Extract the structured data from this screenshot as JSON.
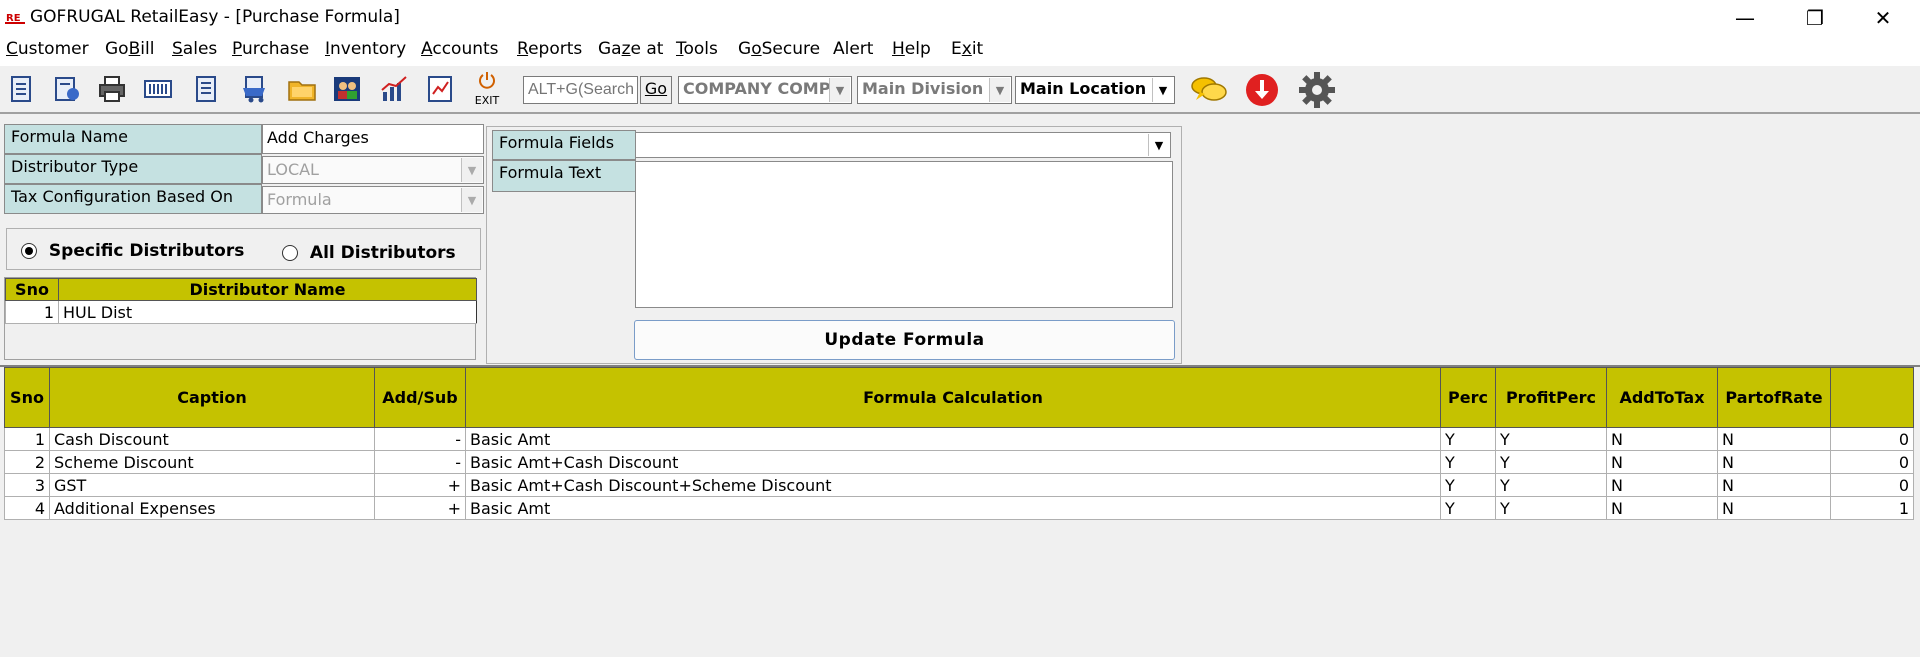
{
  "window": {
    "title": "GOFRUGAL RetailEasy - [Purchase Formula]",
    "min_glyph": "—",
    "restore_glyph": "❐",
    "close_glyph": "✕"
  },
  "menu": [
    {
      "label": "Customer",
      "u": "C",
      "rest": "ustomer"
    },
    {
      "label": "GoBill",
      "u": "",
      "pre": "Go",
      "ul": "B",
      "post": "ill"
    },
    {
      "label": "Sales",
      "u": "S",
      "rest": "ales"
    },
    {
      "label": "Purchase",
      "u": "P",
      "rest": "urchase"
    },
    {
      "label": "Inventory",
      "u": "I",
      "rest": "nventory"
    },
    {
      "label": "Accounts",
      "u": "A",
      "rest": "ccounts"
    },
    {
      "label": "Reports",
      "u": "R",
      "rest": "eports"
    },
    {
      "label": "Gaze at",
      "pre": "Ga",
      "ul": "z",
      "post": "e at"
    },
    {
      "label": "Tools",
      "u": "T",
      "rest": "ools"
    },
    {
      "label": "GoSecure",
      "pre": "G",
      "ul": "o",
      "post": "Secure"
    },
    {
      "label": "Alert",
      "pre": "Alert",
      "ul": "",
      "post": ""
    },
    {
      "label": "Help",
      "u": "H",
      "rest": "elp"
    },
    {
      "label": "Exit",
      "pre": "E",
      "ul": "x",
      "post": "it"
    }
  ],
  "toolbar": {
    "exit_label": "EXIT",
    "search_placeholder": "ALT+G(Search",
    "go_label": "Go",
    "company": "COMPANY COMPA",
    "division": "Main Division",
    "location": "Main Location"
  },
  "form": {
    "formula_name_label": "Formula Name",
    "formula_name_value": "Add Charges",
    "distributor_type_label": "Distributor Type",
    "distributor_type_value": "LOCAL",
    "tax_config_label": "Tax Configuration Based On",
    "tax_config_value": "Formula",
    "formula_fields_label": "Formula Fields",
    "formula_fields_value": "",
    "formula_text_label": "Formula Text",
    "formula_text_value": "",
    "update_button": "Update Formula",
    "radio_specific": "Specific Distributors",
    "radio_all": "All Distributors",
    "radio_selected": "specific"
  },
  "distributor_grid": {
    "headers": [
      "Sno",
      "Distributor Name"
    ],
    "rows": [
      [
        "1",
        "HUL Dist"
      ]
    ]
  },
  "formula_grid": {
    "headers": [
      "Sno",
      "Caption",
      "Add/Sub",
      "Formula Calculation",
      "Perc",
      "ProfitPerc",
      "AddToTax",
      "PartofRate",
      ""
    ],
    "rows": [
      [
        "1",
        "Cash Discount",
        "-",
        "Basic Amt",
        "Y",
        "Y",
        "N",
        "N",
        "0"
      ],
      [
        "2",
        "Scheme Discount",
        "-",
        "Basic Amt+Cash Discount",
        "Y",
        "Y",
        "N",
        "N",
        "0"
      ],
      [
        "3",
        "GST",
        "+",
        "Basic Amt+Cash Discount+Scheme Discount",
        "Y",
        "Y",
        "N",
        "N",
        "0"
      ],
      [
        "4",
        "Additional Expenses",
        "+",
        "Basic Amt",
        "Y",
        "Y",
        "N",
        "N",
        "1"
      ]
    ]
  },
  "colors": {
    "label_bg": "#c5e1e1",
    "grid_header": "#c5c200",
    "alert_red": "#e02020"
  }
}
